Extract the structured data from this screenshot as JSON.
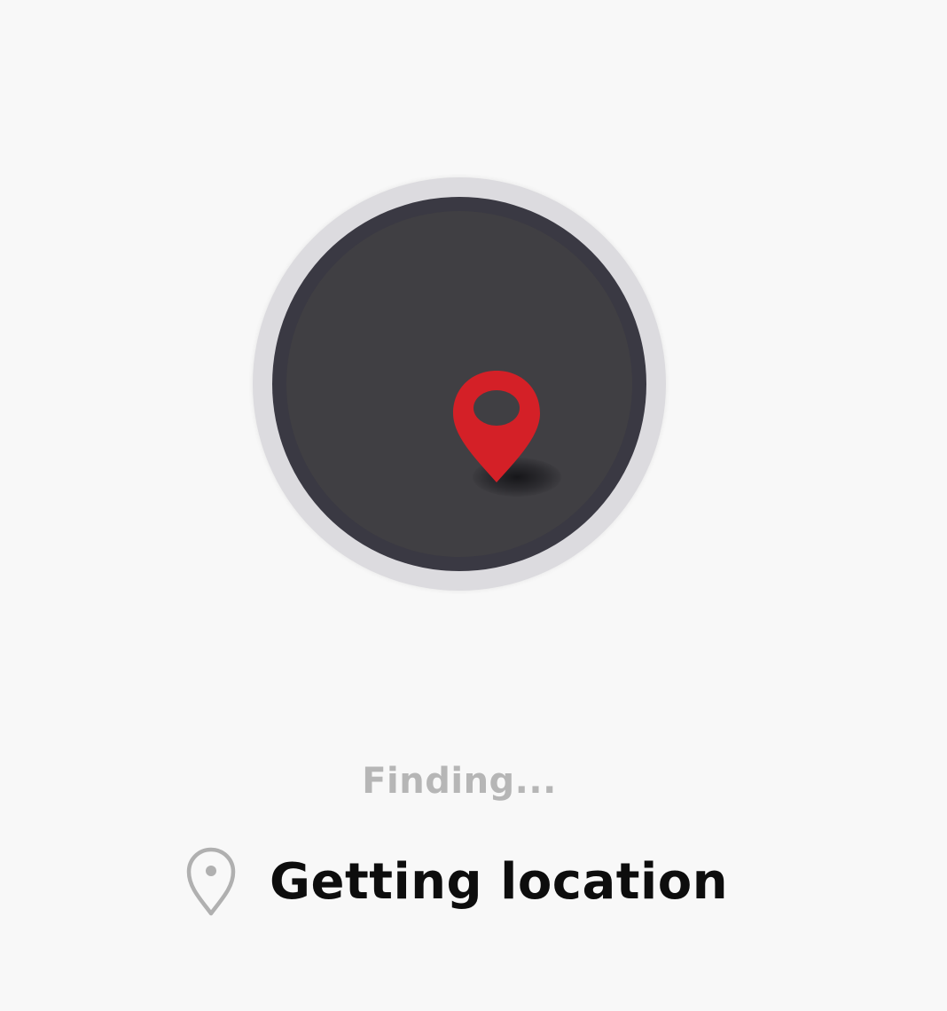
{
  "status": {
    "finding_label": "Finding...",
    "location_label": "Getting location"
  },
  "icons": {
    "center_pin": "map-pin-icon",
    "location_pin": "location-pin-outline-icon"
  },
  "colors": {
    "background": "#f8f8f8",
    "ring_outer": "#dcdbdf",
    "ring_inner": "#3a3943",
    "circle_fill": "#403f43",
    "pin_red": "#d42027",
    "finding_text": "#b6b6b6",
    "location_text": "#0d0d0d",
    "outline_icon": "#b0b0b0"
  }
}
